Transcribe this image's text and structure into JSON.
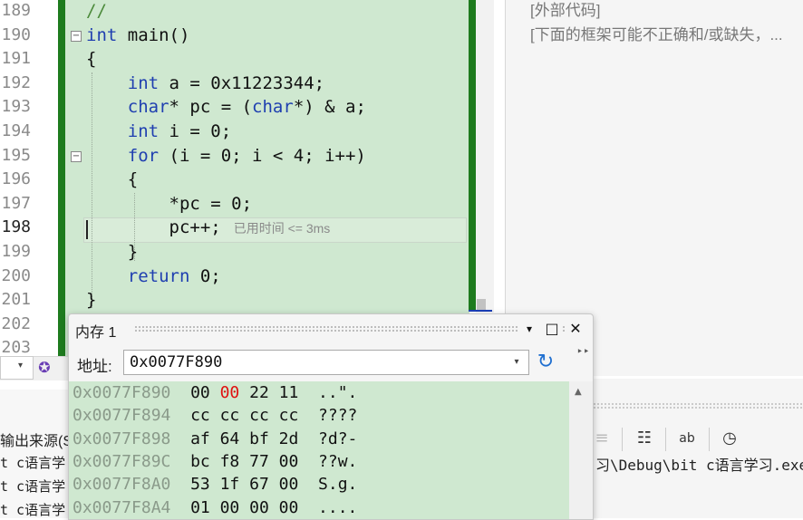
{
  "editor": {
    "line_numbers": [
      "189",
      "190",
      "191",
      "192",
      "193",
      "194",
      "195",
      "196",
      "197",
      "198",
      "199",
      "200",
      "201",
      "202",
      "203"
    ],
    "lines": [
      [
        {
          "t": "//",
          "c": "cm"
        }
      ],
      [
        {
          "t": "int",
          "c": "kw"
        },
        {
          "t": " main()",
          "c": ""
        }
      ],
      [
        {
          "t": "{",
          "c": ""
        }
      ],
      [
        {
          "t": "    ",
          "c": ""
        },
        {
          "t": "int",
          "c": "kw"
        },
        {
          "t": " a = 0x11223344;",
          "c": ""
        }
      ],
      [
        {
          "t": "    ",
          "c": ""
        },
        {
          "t": "char",
          "c": "kw"
        },
        {
          "t": "* pc = (",
          "c": ""
        },
        {
          "t": "char",
          "c": "kw"
        },
        {
          "t": "*) & a;",
          "c": ""
        }
      ],
      [
        {
          "t": "    ",
          "c": ""
        },
        {
          "t": "int",
          "c": "kw"
        },
        {
          "t": " i = 0;",
          "c": ""
        }
      ],
      [
        {
          "t": "    ",
          "c": ""
        },
        {
          "t": "for",
          "c": "kw"
        },
        {
          "t": " (i = 0; i < 4; i++)",
          "c": ""
        }
      ],
      [
        {
          "t": "    {",
          "c": ""
        }
      ],
      [
        {
          "t": "        *pc = 0;",
          "c": ""
        }
      ],
      [
        {
          "t": "        pc++;",
          "c": ""
        }
      ],
      [
        {
          "t": "    }",
          "c": ""
        }
      ],
      [
        {
          "t": "    ",
          "c": ""
        },
        {
          "t": "return",
          "c": "kw"
        },
        {
          "t": " 0;",
          "c": ""
        }
      ],
      [
        {
          "t": "}",
          "c": ""
        }
      ]
    ],
    "perf_hint": "已用时间 <= 3ms"
  },
  "callstack": {
    "external": "[外部代码]",
    "note": "[下面的框架可能不正确和/或缺失，..."
  },
  "output": {
    "source_label": "输出来源(S",
    "lines": [
      "t c语言学",
      "t c语言学",
      "t c语言学"
    ],
    "path_text": "习\\Debug\\bit c语言学习.exe"
  },
  "memory": {
    "title": "内存 1",
    "address_label": "地址:",
    "address_value": "0x0077F890",
    "rows": [
      {
        "addr": "0x0077F890",
        "bytes": [
          "00",
          "00",
          "22",
          "11"
        ],
        "ascii": "..\".",
        "changed": [
          1
        ]
      },
      {
        "addr": "0x0077F894",
        "bytes": [
          "cc",
          "cc",
          "cc",
          "cc"
        ],
        "ascii": "????",
        "changed": []
      },
      {
        "addr": "0x0077F898",
        "bytes": [
          "af",
          "64",
          "bf",
          "2d"
        ],
        "ascii": "?d?-",
        "changed": []
      },
      {
        "addr": "0x0077F89C",
        "bytes": [
          "bc",
          "f8",
          "77",
          "00"
        ],
        "ascii": "??w.",
        "changed": []
      },
      {
        "addr": "0x0077F8A0",
        "bytes": [
          "53",
          "1f",
          "67",
          "00"
        ],
        "ascii": "S.g.",
        "changed": []
      },
      {
        "addr": "0x0077F8A4",
        "bytes": [
          "01",
          "00",
          "00",
          "00"
        ],
        "ascii": "....",
        "changed": []
      }
    ]
  },
  "icons": {
    "dropdown": "▾",
    "pin": "▾",
    "maximize": "□",
    "close": "✕",
    "refresh": "↻",
    "more": "⋮"
  },
  "colors": {
    "code_bg": "#cfe8d0",
    "accent_green_bar": "#1e7b1e",
    "keyword": "#1f3fb0",
    "changed_byte": "#e01010"
  }
}
